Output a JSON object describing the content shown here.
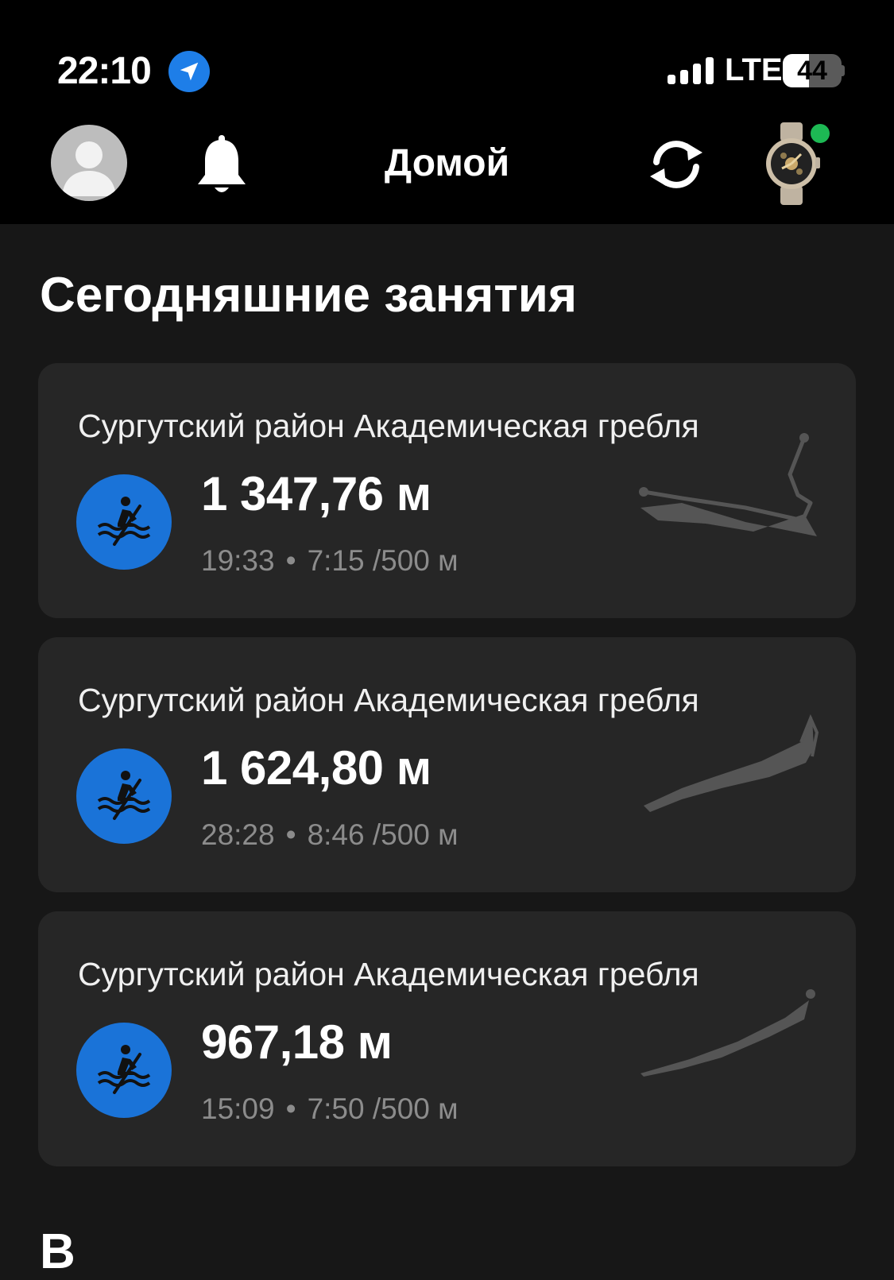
{
  "status_bar": {
    "time": "22:10",
    "network": "LTE",
    "battery": "44",
    "battery_level": 0.44
  },
  "header": {
    "title": "Домой"
  },
  "section": {
    "title": "Сегодняшние занятия"
  },
  "activities": [
    {
      "title": "Сургутский район Академическая гребля",
      "distance": "1 347,76 м",
      "duration": "19:33",
      "pace": "7:15 /500 м"
    },
    {
      "title": "Сургутский район Академическая гребля",
      "distance": "1 624,80 м",
      "duration": "28:28",
      "pace": "8:46 /500 м"
    },
    {
      "title": "Сургутский район Академическая гребля",
      "distance": "967,18 м",
      "duration": "15:09",
      "pace": "7:50 /500 м"
    }
  ],
  "separator": "•",
  "next_section": {
    "title": "В"
  },
  "colors": {
    "accent": "#1a73d8",
    "background": "#171717",
    "card": "#262626",
    "status_online": "#1db954"
  }
}
